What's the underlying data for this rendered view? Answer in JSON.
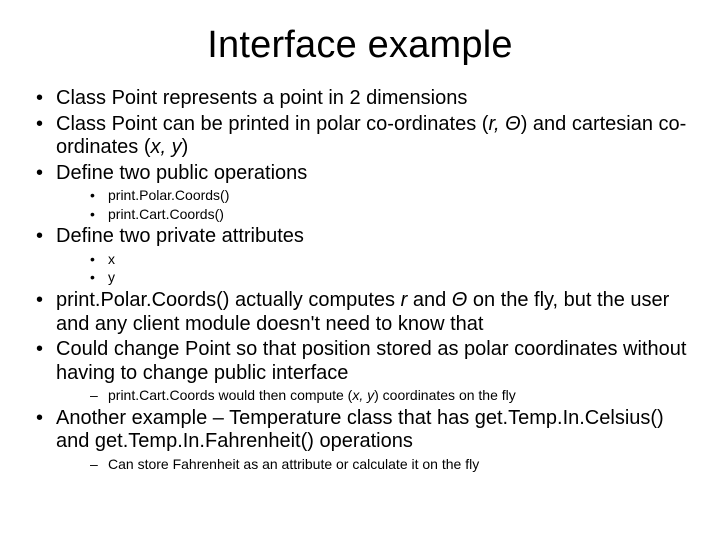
{
  "title": "Interface example",
  "b1": "Class Point represents a point in 2 dimensions",
  "b2a": "Class Point can be printed in polar co-ordinates (",
  "b2b": "r, Θ",
  "b2c": ") and cartesian co-ordinates (",
  "b2d": "x, y",
  "b2e": ")",
  "b3": "Define two public operations",
  "b3s1": "print.Polar.Coords()",
  "b3s2": "print.Cart.Coords()",
  "b4": "Define two private attributes",
  "b4s1": "x",
  "b4s2": "y",
  "b5a": "print.Polar.Coords() actually computes ",
  "b5b": "r",
  "b5c": " and ",
  "b5d": "Θ",
  "b5e": " on the fly, but the user and any client module doesn't need to know that",
  "b6": "Could change Point so that position stored as polar coordinates without having to change public interface",
  "b6s1a": "print.Cart.Coords would then compute (",
  "b6s1b": "x, y",
  "b6s1c": ") coordinates on the fly",
  "b7": "Another example – Temperature class that has get.Temp.In.Celsius() and get.Temp.In.Fahrenheit() operations",
  "b7s1": "Can store Fahrenheit as an attribute or calculate it on the fly"
}
